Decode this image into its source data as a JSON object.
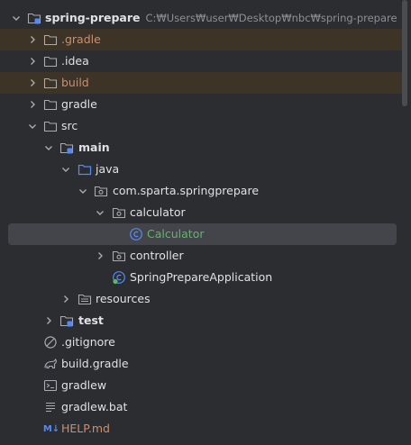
{
  "project": {
    "name": "spring-prepare",
    "path": "C:₩Users₩user₩Desktop₩nbc₩spring-prepare"
  },
  "tree": {
    "gradle_hidden": ".gradle",
    "idea": ".idea",
    "build": "build",
    "gradle": "gradle",
    "src": "src",
    "main": "main",
    "java": "java",
    "package": "com.sparta.springprepare",
    "calculator_pkg": "calculator",
    "calculator_class": "Calculator",
    "controller_pkg": "controller",
    "app_class": "SpringPrepareApplication",
    "resources": "resources",
    "test": "test",
    "gitignore": ".gitignore",
    "build_gradle": "build.gradle",
    "gradlew": "gradlew",
    "gradlew_bat": "gradlew.bat",
    "help_md": "HELP.md",
    "md_badge": "M↓"
  },
  "colors": {
    "background": "#2b2d30",
    "excluded_row": "#3d3326",
    "selected_row": "#43454a",
    "excluded_text": "#cf8e6d",
    "class_accent": "#5fb865",
    "folder_blue": "#548af7"
  }
}
